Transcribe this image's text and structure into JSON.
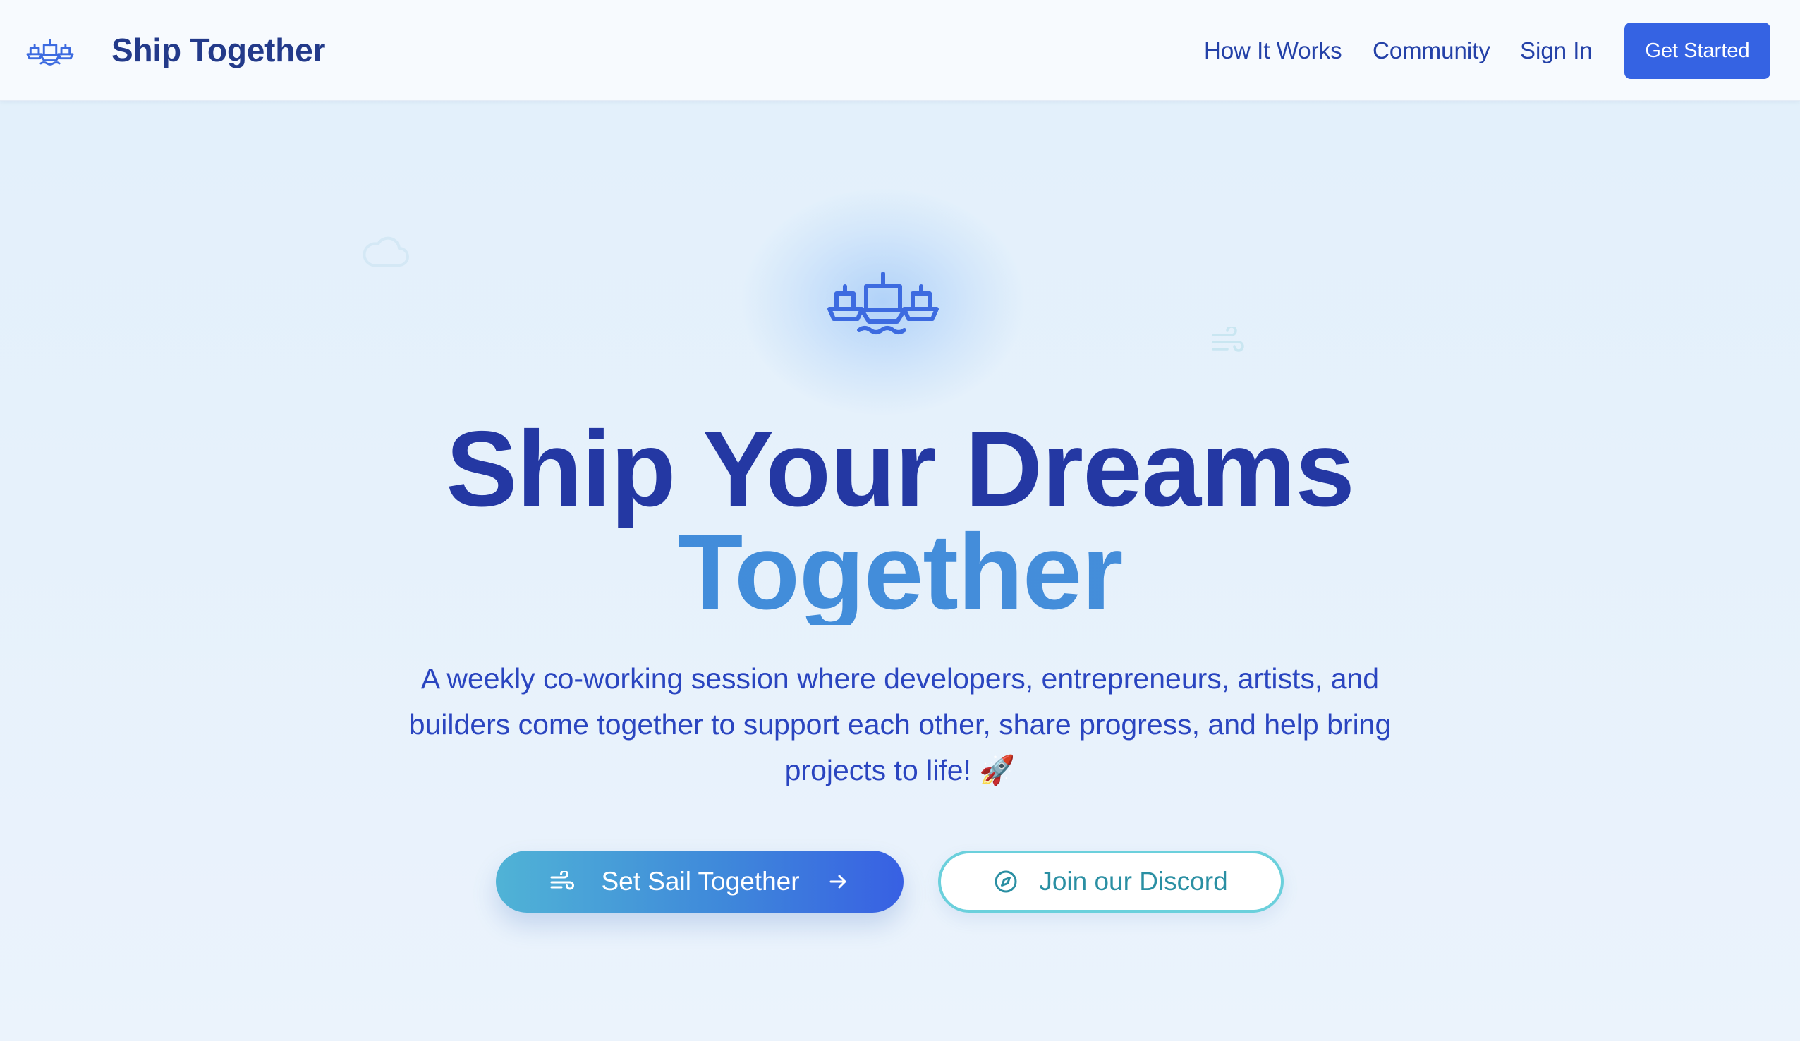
{
  "header": {
    "brand": "Ship Together",
    "logo_icon": "ships-icon",
    "nav": {
      "how_it_works": "How It Works",
      "community": "Community",
      "sign_in": "Sign In"
    },
    "cta_label": "Get Started"
  },
  "hero": {
    "icon": "ships-icon",
    "headline_line1": "Ship Your Dreams",
    "headline_line2": "Together",
    "lead": "A weekly co-working session where developers, entrepreneurs, artists, and builders come together to support each other, share progress, and help bring projects to life! 🚀",
    "primary_button": {
      "label": "Set Sail Together",
      "icon_left": "wind-icon",
      "icon_right": "arrow-right-icon"
    },
    "secondary_button": {
      "label": "Join our Discord",
      "icon": "compass-icon"
    },
    "decorations": [
      "cloud-icon",
      "wind-icon"
    ]
  },
  "colors": {
    "brand_dark": "#233a8a",
    "headline": "#2438a3",
    "headline_accent": "#418ed9",
    "link": "#2441a8",
    "primary": "#3563e3",
    "teal": "#2a8fa3",
    "teal_border": "#6bd0dc"
  }
}
